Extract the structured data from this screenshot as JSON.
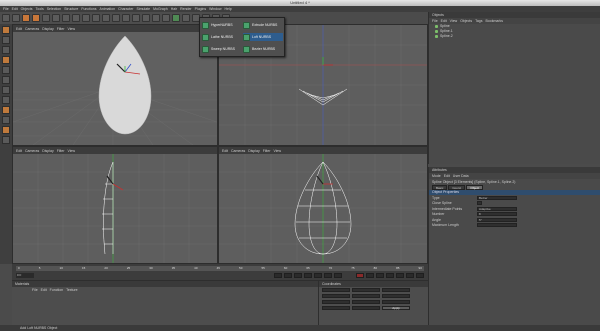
{
  "window": {
    "title": "Untitled 4 *"
  },
  "menu": [
    "File",
    "Edit",
    "Objects",
    "Tools",
    "Selection",
    "Structure",
    "Functions",
    "Animation",
    "Character",
    "Simulate",
    "MoGraph",
    "Hair",
    "Render",
    "Plugins",
    "Window",
    "Help"
  ],
  "viewport_menu": [
    "Edit",
    "Cameras",
    "Display",
    "Filter",
    "View"
  ],
  "viewport_labels": {
    "top_left": "Perspective",
    "bottom_left": "Right",
    "bottom_right": "Front"
  },
  "popup": {
    "items": [
      "HyperNURBS",
      "Extrude NURBS",
      "Lathe NURBS",
      "Loft NURBS",
      "Sweep NURBS",
      "Bezier NURBS"
    ],
    "selected": "Loft NURBS"
  },
  "objects_panel": {
    "title": "Objects",
    "menu": [
      "File",
      "Edit",
      "View",
      "Objects",
      "Tags",
      "Bookmarks"
    ],
    "items": [
      "Spline",
      "Spline.1",
      "Spline.2"
    ]
  },
  "attributes_panel": {
    "title": "Attributes",
    "menu": [
      "Mode",
      "Edit",
      "User Data"
    ],
    "selection_label": "Spline Object [3 Elements] (Spline, Spline.1, Spline.2)",
    "tabs": [
      "Basic",
      "Coord.",
      "Object"
    ],
    "active_tab": "Object",
    "section": "Object Properties",
    "rows": [
      {
        "label": "Type",
        "value": "Bezier"
      },
      {
        "label": "Close Spline",
        "value": ""
      },
      {
        "label": "Intermediate Points",
        "value": "Adaptive"
      },
      {
        "label": "Number",
        "value": "8"
      },
      {
        "label": "Angle",
        "value": "5°"
      },
      {
        "label": "Maximum Length",
        "value": ""
      }
    ]
  },
  "timeline": {
    "ticks": [
      "0",
      "5",
      "10",
      "15",
      "20",
      "25",
      "30",
      "35",
      "40",
      "45",
      "50",
      "55",
      "60",
      "65",
      "70",
      "75",
      "80",
      "85",
      "90"
    ],
    "current_frame": "0 F"
  },
  "materials_panel": {
    "title": "Materials",
    "menu": [
      "File",
      "Edit",
      "Function",
      "Texture"
    ]
  },
  "coordinates_panel": {
    "title": "Coordinates",
    "apply_label": "Apply"
  },
  "status": {
    "text": "Add Loft NURBS Object"
  },
  "colors": {
    "accent": "#c8773a",
    "nurbs_icon": "#4aa26d",
    "selection": "#2e5d8e"
  }
}
